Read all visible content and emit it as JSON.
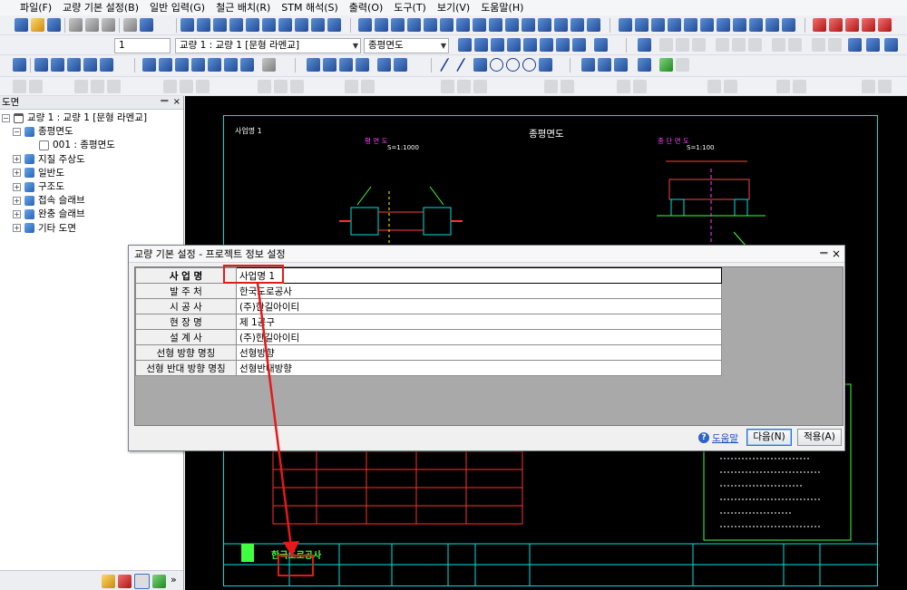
{
  "menu": [
    "파일(F)",
    "교량 기본 설정(B)",
    "일반 입력(G)",
    "철근 배치(R)",
    "STM 해석(S)",
    "출력(O)",
    "도구(T)",
    "보기(V)",
    "도움말(H)"
  ],
  "toolbar": {
    "page_number": "1",
    "bridge_combo": "교량 1 : 교량 1 [문형 라멘교]",
    "view_combo": "종평면도"
  },
  "left_panel": {
    "title": "도면",
    "pin": "ᆖ",
    "close": "×",
    "tree": [
      {
        "label": "교량 1 : 교량 1 [문형 라멘교]",
        "level": 0,
        "expand": "−",
        "icon": "bridge-icon"
      },
      {
        "label": "종평면도",
        "level": 1,
        "expand": "−",
        "icon": "folder-icon"
      },
      {
        "label": "001 : 종평면도",
        "level": 2,
        "expand": "",
        "icon": "page-icon"
      },
      {
        "label": "지질 주상도",
        "level": 1,
        "expand": "+",
        "icon": "folder-icon"
      },
      {
        "label": "일반도",
        "level": 1,
        "expand": "+",
        "icon": "folder-icon"
      },
      {
        "label": "구조도",
        "level": 1,
        "expand": "+",
        "icon": "folder-icon"
      },
      {
        "label": "접속 슬래브",
        "level": 1,
        "expand": "+",
        "icon": "folder-icon"
      },
      {
        "label": "완충 슬래브",
        "level": 1,
        "expand": "+",
        "icon": "folder-icon"
      },
      {
        "label": "기타 도면",
        "level": 1,
        "expand": "+",
        "icon": "folder-icon"
      }
    ],
    "more": "»"
  },
  "drawing": {
    "title": "종평면도",
    "sheet_label": "사업명 1",
    "plan_label": "평 면 도",
    "plan_scale": "S=1:1000",
    "section_label": "종 단 면 도",
    "section_scale": "S=1:100",
    "company": "한국도로공사"
  },
  "dialog": {
    "title": "교량 기본 설정 - 프로젝트 정보 설정",
    "pin": "ᆖ",
    "close": "×",
    "rows": [
      {
        "label": "사 업 명",
        "value": "사업명 1"
      },
      {
        "label": "발 주 처",
        "value": "한국도로공사"
      },
      {
        "label": "시 공 사",
        "value": "(주)한길아이티"
      },
      {
        "label": "현 장 명",
        "value": "제 1공구"
      },
      {
        "label": "설 계 사",
        "value": "(주)한길아이티"
      },
      {
        "label": "선형 방향 명칭",
        "value": "선형방향"
      },
      {
        "label": "선형 반대 방향 명칭",
        "value": "선형반대방향"
      }
    ],
    "help_icon": "?",
    "help": "도움말",
    "next": "다음(N)",
    "apply": "적용(A)"
  },
  "colors": {
    "cad_border": "#00e0e0",
    "annotation": "#e51919"
  }
}
